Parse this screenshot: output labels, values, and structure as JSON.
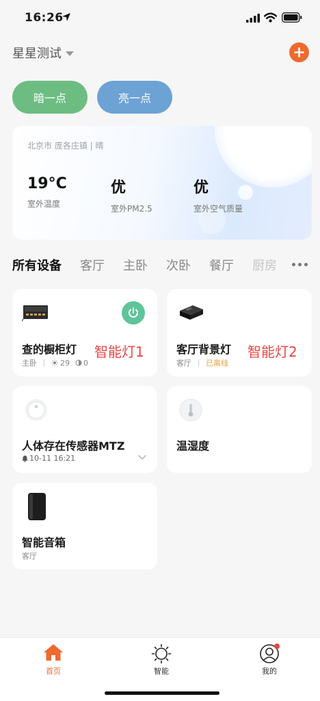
{
  "status_bar": {
    "time": "16:26"
  },
  "header": {
    "home_name": "星星测试"
  },
  "scenes": [
    {
      "label": "暗一点"
    },
    {
      "label": "亮一点"
    }
  ],
  "weather": {
    "location": "北京市 庞各庄镇 | 晴",
    "stats": [
      {
        "value": "19°C",
        "label": "室外温度"
      },
      {
        "value": "优",
        "label": "室外PM2.5"
      },
      {
        "value": "优",
        "label": "室外空气质量"
      }
    ]
  },
  "room_tabs": [
    "所有设备",
    "客厅",
    "主卧",
    "次卧",
    "餐厅",
    "厨房"
  ],
  "devices": [
    {
      "name": "查的橱柜灯",
      "room": "主卧",
      "brightness": "29",
      "color_temp": "0",
      "overlay_label": "智能灯1",
      "power_on": true
    },
    {
      "name": "客厅背景灯",
      "room": "客厅",
      "status": "已离线",
      "overlay_label": "智能灯2"
    },
    {
      "name": "人体存在传感器MTZ",
      "last_event": "10-11 16:21"
    },
    {
      "name": "温湿度"
    },
    {
      "name": "智能音箱",
      "room": "客厅"
    }
  ],
  "bottom_tabs": [
    {
      "label": "首页"
    },
    {
      "label": "智能"
    },
    {
      "label": "我的"
    }
  ],
  "colors": {
    "accent": "#ef6a2c",
    "scene_dark": "#6dbd82",
    "scene_bright": "#6da2d4",
    "power_on": "#5fc49a",
    "offline": "#e8a23a",
    "overlay_red": "#e84545"
  }
}
